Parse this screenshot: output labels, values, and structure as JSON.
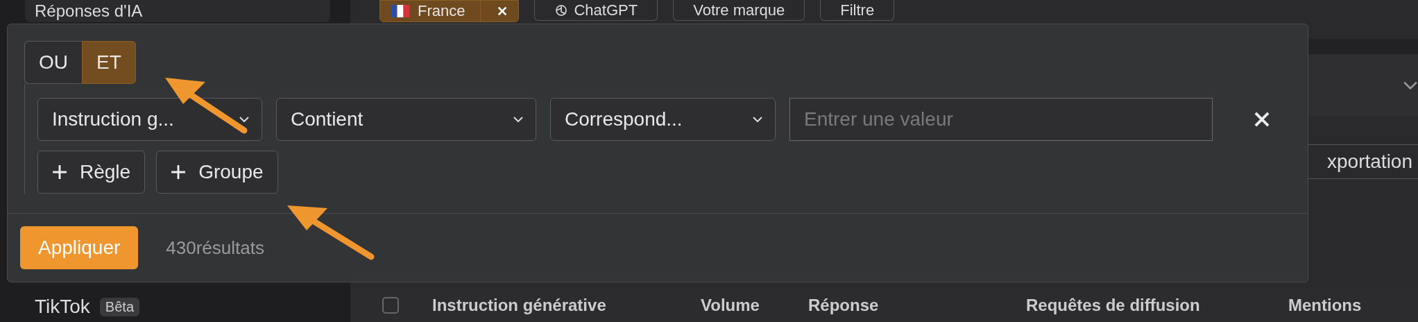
{
  "sidebar": {
    "items": [
      {
        "label": "Réponses d'IA"
      },
      {
        "label": "TikTok",
        "badge": "Bêta"
      }
    ]
  },
  "filter_bar": {
    "country": "France",
    "buttons": [
      "ChatGPT",
      "Votre marque",
      "Filtre"
    ]
  },
  "export_button": "xportation",
  "table": {
    "select_all": {
      "checked": false
    },
    "columns": [
      "Instruction générative",
      "Volume",
      "Réponse",
      "Requêtes de diffusion",
      "Mentions"
    ]
  },
  "filter_popup": {
    "logic": [
      {
        "label": "OU",
        "selected": false
      },
      {
        "label": "ET",
        "selected": true
      }
    ],
    "rules": [
      {
        "field": "Instruction g...",
        "operator": "Contient",
        "match": "Correspond...",
        "value_placeholder": "Entrer une valeur"
      }
    ],
    "add_buttons": [
      "Règle",
      "Groupe"
    ],
    "apply": "Appliquer",
    "results": "430résultats"
  }
}
